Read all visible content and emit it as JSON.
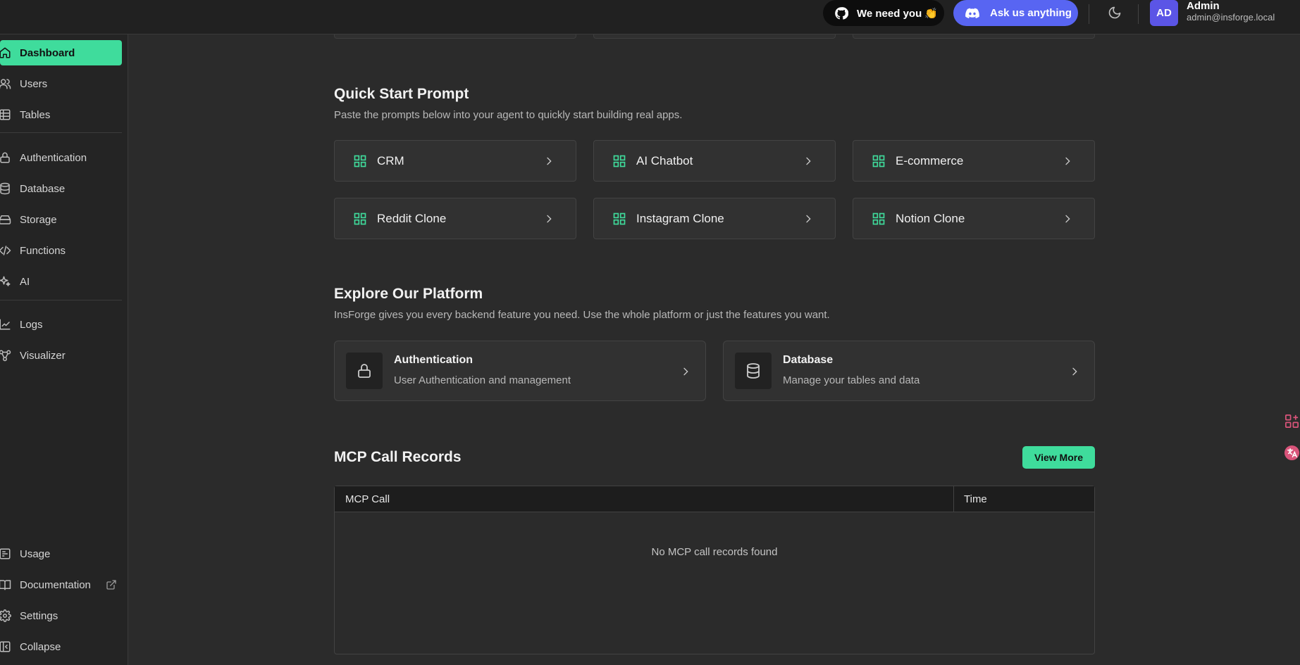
{
  "header": {
    "github_label": "We need you 👏",
    "discord_label": "Ask us anything",
    "avatar_initials": "AD",
    "user_name": "Admin",
    "user_email": "admin@insforge.local"
  },
  "sidebar": {
    "items": [
      {
        "label": "Dashboard",
        "icon": "home-icon",
        "active": true
      },
      {
        "label": "Users",
        "icon": "users-icon"
      },
      {
        "label": "Tables",
        "icon": "table-icon"
      },
      {
        "label": "Authentication",
        "icon": "lock-icon"
      },
      {
        "label": "Database",
        "icon": "database-icon"
      },
      {
        "label": "Storage",
        "icon": "hard-drive-icon"
      },
      {
        "label": "Functions",
        "icon": "code-icon"
      },
      {
        "label": "AI",
        "icon": "sparkles-icon"
      },
      {
        "label": "Logs",
        "icon": "chart-line-icon"
      },
      {
        "label": "Visualizer",
        "icon": "workflow-icon"
      }
    ],
    "bottom": [
      {
        "label": "Usage",
        "icon": "usage-icon"
      },
      {
        "label": "Documentation",
        "icon": "book-icon"
      },
      {
        "label": "Settings",
        "icon": "gear-icon"
      },
      {
        "label": "Collapse",
        "icon": "collapse-icon"
      }
    ]
  },
  "quick_start": {
    "title": "Quick Start Prompt",
    "subtitle": "Paste the prompts below into your agent to quickly start building real apps.",
    "cards": [
      "CRM",
      "AI Chatbot",
      "E-commerce",
      "Reddit Clone",
      "Instagram Clone",
      "Notion Clone"
    ]
  },
  "explore": {
    "title": "Explore Our Platform",
    "subtitle": "InsForge gives you every backend feature you need. Use the whole platform or just the features you want.",
    "cards": [
      {
        "title": "Authentication",
        "description": "User Authentication and management",
        "icon": "lock-icon"
      },
      {
        "title": "Database",
        "description": "Manage your tables and data",
        "icon": "database-icon"
      }
    ]
  },
  "mcp": {
    "title": "MCP Call Records",
    "view_more": "View More",
    "columns": [
      "MCP Call",
      "Time"
    ],
    "empty_text": "No MCP call records found"
  },
  "colors": {
    "accent": "#3fdc9c",
    "discord": "#5865f2",
    "avatar": "#5b55e6"
  }
}
